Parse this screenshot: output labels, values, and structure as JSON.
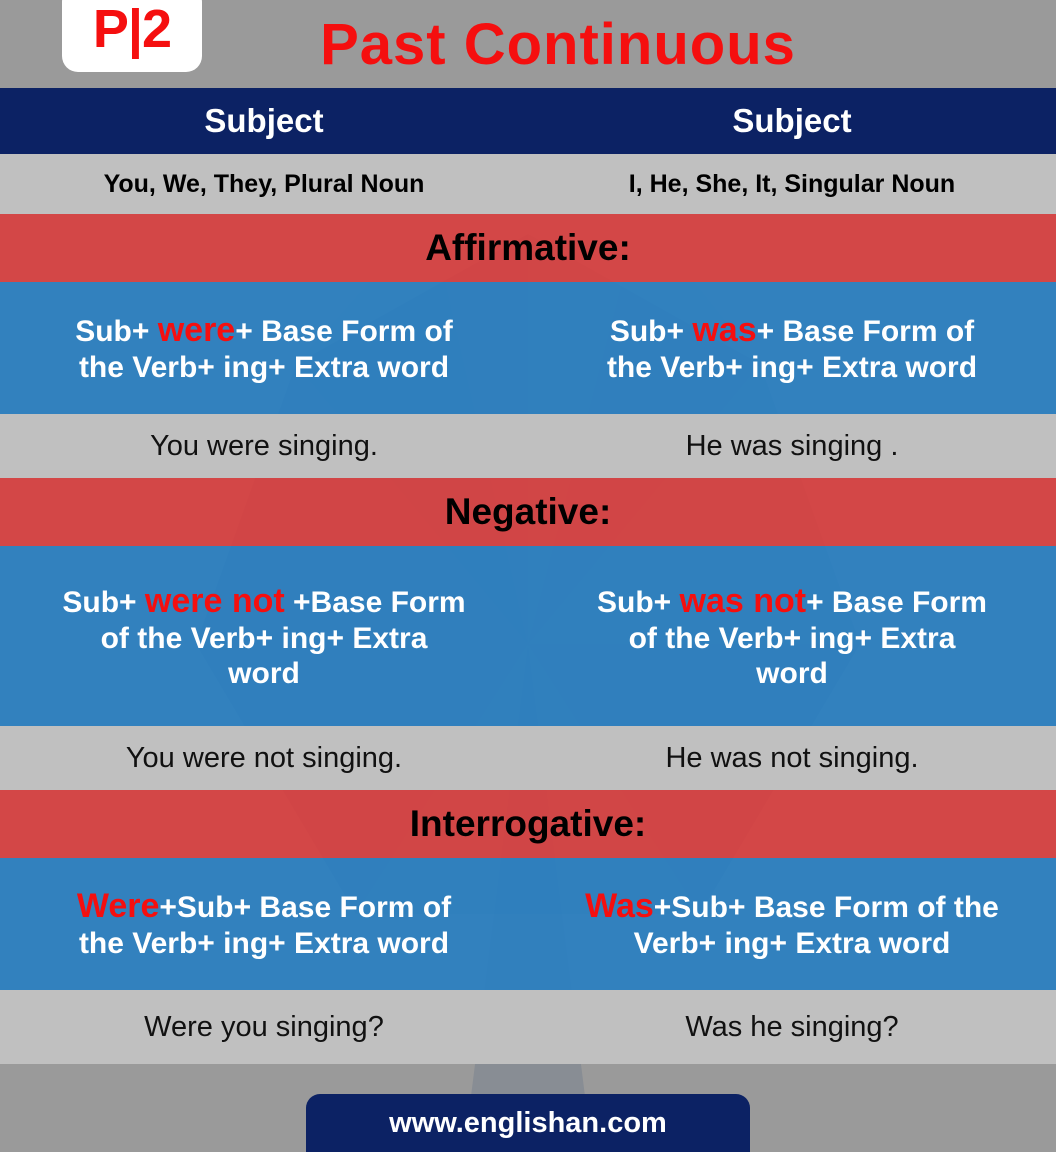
{
  "header": {
    "logo_text": "P|2",
    "title": "Past  Continuous",
    "title_color": "#f50f0f",
    "bg_color": "#9a9a9a"
  },
  "colors": {
    "navy": "#0c2264",
    "red_band": "#d84040",
    "blue_band": "#2a7fc1",
    "gray_row": "#c0c0c0",
    "gray_header": "#9a9a9a",
    "keyword_red": "#f50f0f",
    "white": "#ffffff",
    "black": "#000000"
  },
  "subject_header": {
    "left": "Subject",
    "right": "Subject"
  },
  "subject_list": {
    "left": "You, We, They, Plural Noun",
    "right": "I, He, She, It, Singular Noun"
  },
  "sections": [
    {
      "label": "Affirmative:",
      "formula_left": {
        "line1_pre": "Sub+ ",
        "keyword": "were",
        "line1_post": "+ Base Form of",
        "line2": "the Verb+ ing+ Extra word"
      },
      "formula_right": {
        "line1_pre": "Sub+ ",
        "keyword": "was",
        "line1_post": "+  Base Form of",
        "line2": "the Verb+ ing+ Extra word"
      },
      "example_left": "You were singing.",
      "example_right": "He was singing ."
    },
    {
      "label": "Negative:",
      "formula_left": {
        "line1_pre": "Sub+ ",
        "keyword": "were not",
        "line1_post": " +Base Form",
        "line2": "of the Verb+ ing+ Extra",
        "line3": "word"
      },
      "formula_right": {
        "line1_pre": "Sub+ ",
        "keyword": "was not",
        "line1_post": "+ Base Form",
        "line2": "of the Verb+ ing+ Extra",
        "line3": "word"
      },
      "example_left": "You were not singing.",
      "example_right": "He was not singing."
    },
    {
      "label": "Interrogative:",
      "formula_left": {
        "line1_pre": "",
        "keyword": "Were",
        "line1_post": "+Sub+ Base Form of",
        "line2": "the Verb+ ing+ Extra word"
      },
      "formula_right": {
        "line1_pre": "",
        "keyword": "Was",
        "line1_post": "+Sub+ Base Form of the",
        "line2": "Verb+ ing+ Extra word"
      },
      "example_left": "Were you singing?",
      "example_right": "Was he singing?"
    }
  ],
  "footer": {
    "website": "www.englishan.com"
  }
}
